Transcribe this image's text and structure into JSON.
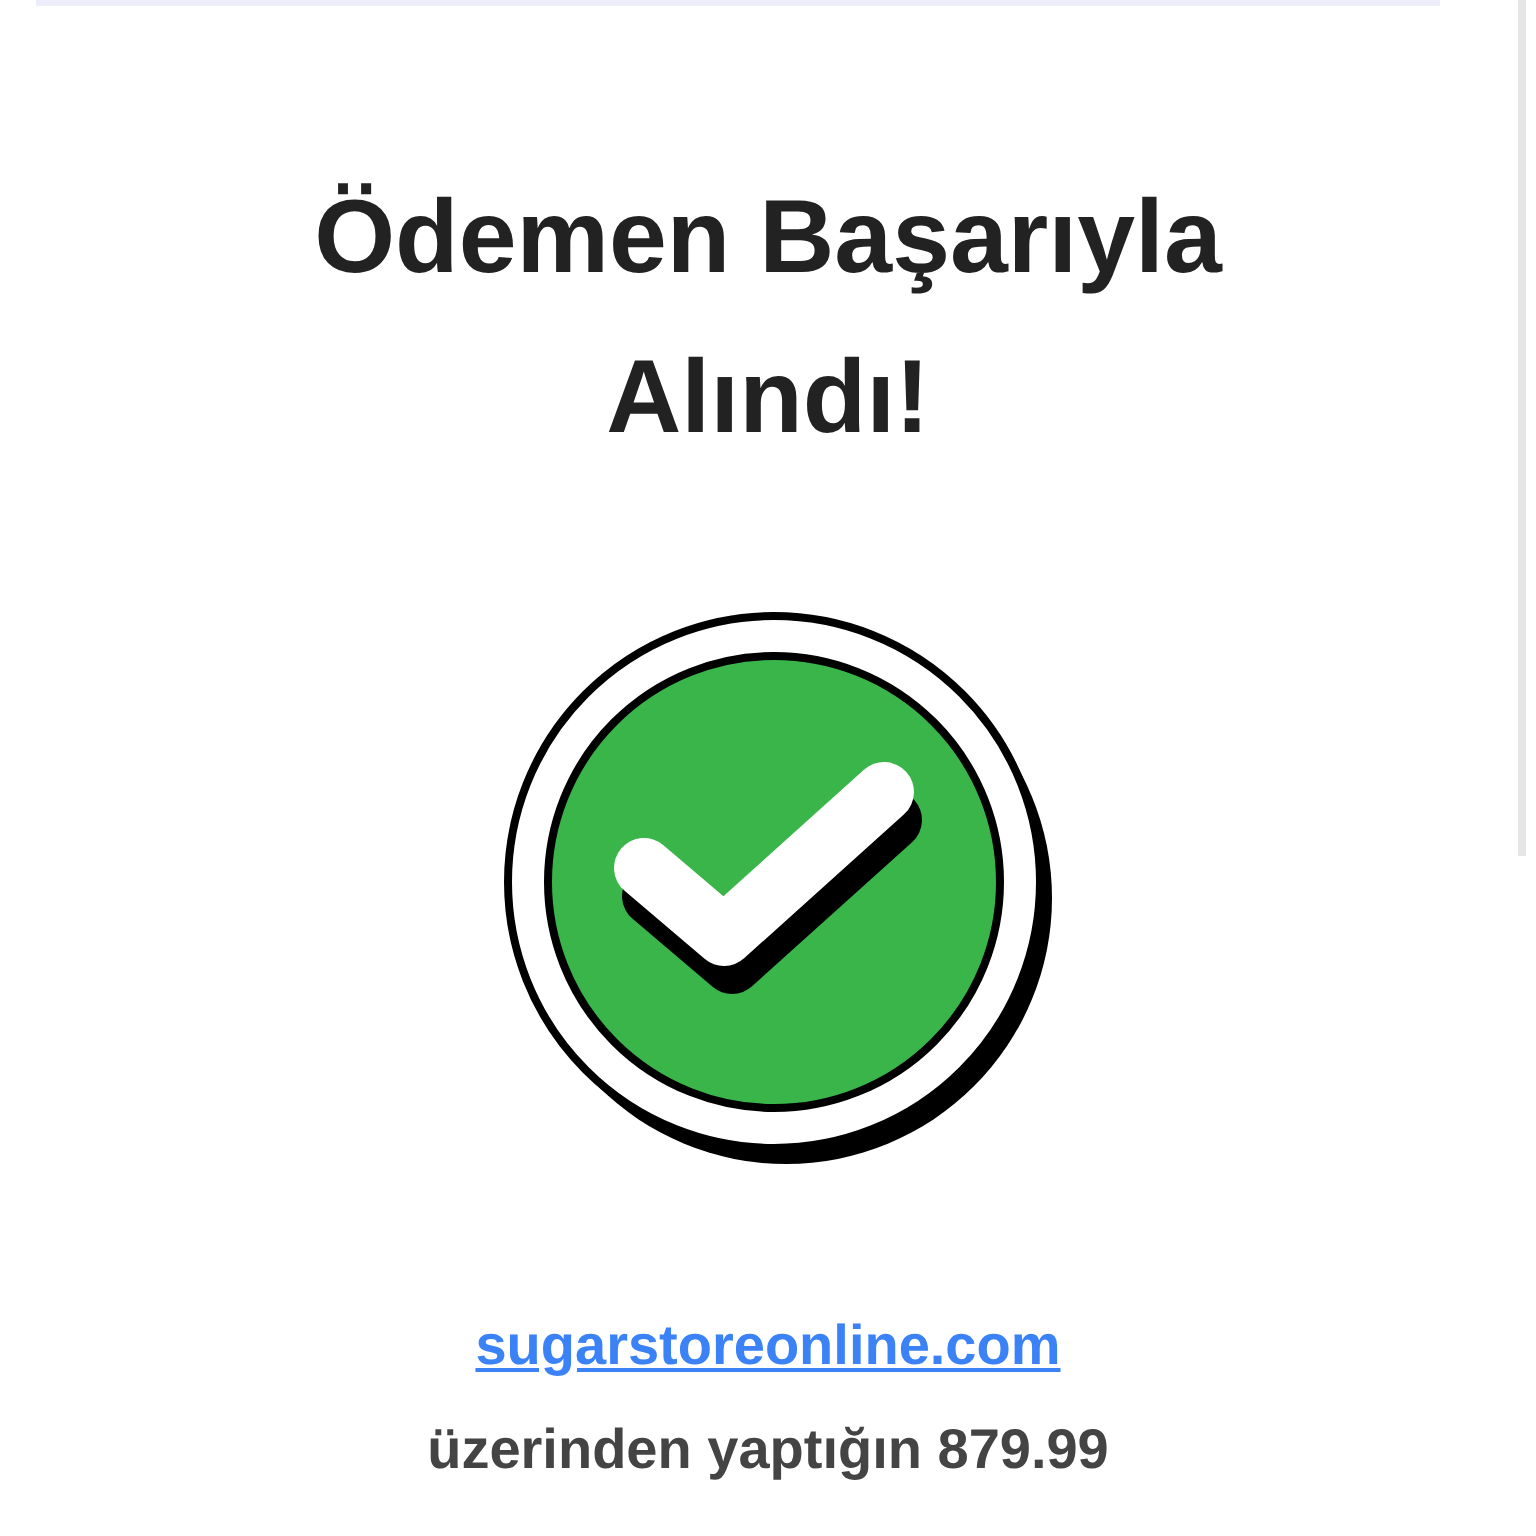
{
  "title": "Ödemen Başarıyla Alındı!",
  "store_link": "sugarstoreonline.com",
  "message": "üzerinden yaptığın 879.99"
}
